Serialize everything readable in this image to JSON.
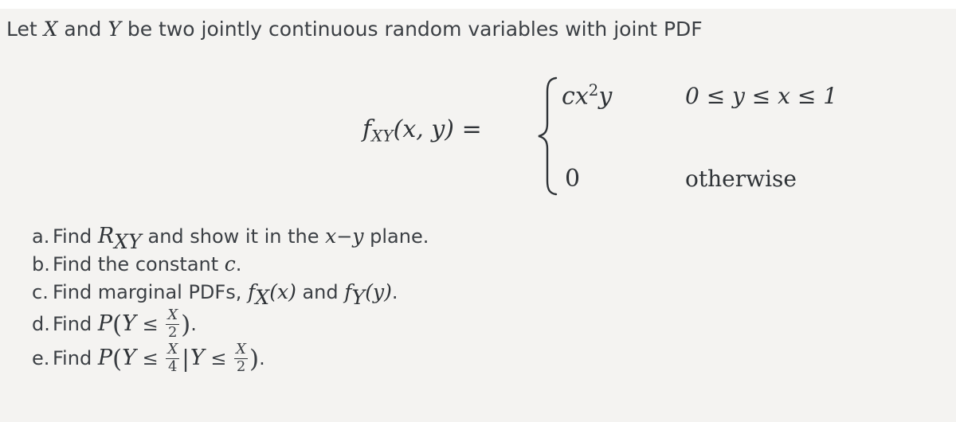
{
  "page": {
    "background_color": "#ffffff",
    "panel_color": "#f4f3f1",
    "text_color": "#3b3f44",
    "math_color": "#2f3337"
  },
  "intro": {
    "before_x": "Let ",
    "var_x": "X",
    "between": " and ",
    "var_y": "Y",
    "after": " be two jointly continuous random variables with joint PDF"
  },
  "formula": {
    "lhs_f": "f",
    "lhs_sub": "XY",
    "lhs_args": "(x, y)",
    "equals": "=",
    "brace": "{",
    "cases": [
      {
        "value_c": "c",
        "value_x": "x",
        "value_exp": "2",
        "value_y": "y",
        "condition": "0 ≤ y ≤ x ≤ 1"
      },
      {
        "value_zero": "0",
        "condition": "otherwise"
      }
    ]
  },
  "questions": [
    {
      "label": "a.",
      "text_1": "Find ",
      "math_1": "R",
      "math_1_sub": "XY",
      "text_2": " and show it in the ",
      "math_2": "x",
      "math_2_op": "−",
      "math_2b": "y",
      "text_3": " plane."
    },
    {
      "label": "b.",
      "text_1": "Find the constant ",
      "math_1": "c",
      "text_2": "."
    },
    {
      "label": "c.",
      "text_1": "Find marginal PDFs, ",
      "math_1": "f",
      "math_1_sub": "X",
      "math_1_args": "(x)",
      "text_2": " and ",
      "math_2": "f",
      "math_2_sub": "Y",
      "math_2_args": "(y)",
      "text_3": "."
    },
    {
      "label": "d.",
      "text_1": "Find ",
      "math_p": "P",
      "open_paren": "(",
      "var_y": "Y",
      "le": "≤",
      "frac_num": "X",
      "frac_den": "2",
      "close_paren": ")",
      "text_2": "."
    },
    {
      "label": "e.",
      "text_1": "Find ",
      "math_p": "P",
      "open_paren": "(",
      "var_y": "Y",
      "le": "≤",
      "frac1_num": "X",
      "frac1_den": "4",
      "cond_bar": "|",
      "var_y2": "Y",
      "le2": "≤",
      "frac2_num": "X",
      "frac2_den": "2",
      "close_paren": ")",
      "text_2": "."
    }
  ]
}
